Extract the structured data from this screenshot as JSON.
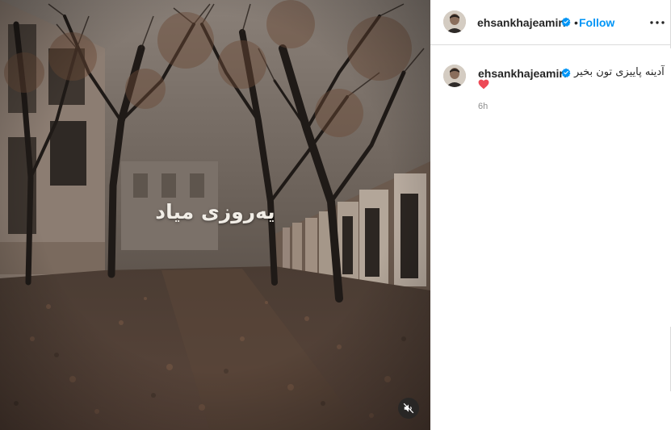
{
  "post": {
    "overlay_text": "یه‌روزی میاد"
  },
  "header": {
    "username": "ehsankhajeamiri",
    "separator": "•",
    "follow_label": "Follow"
  },
  "caption": {
    "username": "ehsankhajeamiri",
    "text": "آدینه پاییزی تون بخیر",
    "time": "6h"
  },
  "colors": {
    "accent": "#0095f6",
    "verified": "#0095f6",
    "heart": "#ed4956",
    "muted_text": "#8e8e8e"
  },
  "icons": {
    "verified": "verified-badge-icon",
    "more": "more-options-icon",
    "mute": "muted-speaker-icon",
    "heart": "red-heart-emoji"
  }
}
